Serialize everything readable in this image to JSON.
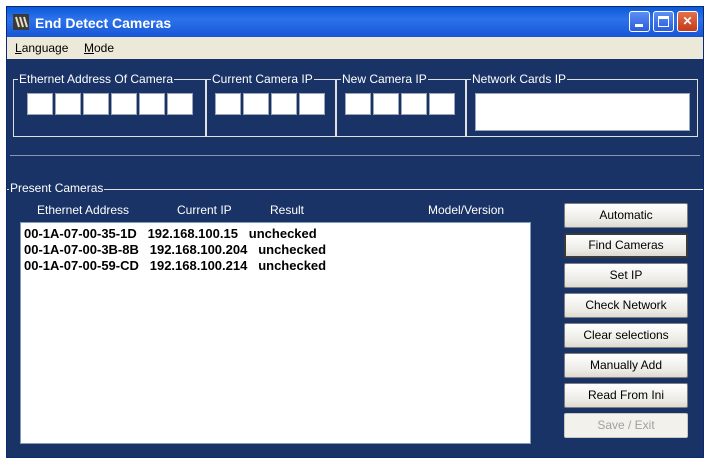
{
  "window": {
    "title": "End Detect Cameras",
    "icon": "app-icon"
  },
  "menu": {
    "items": [
      {
        "accel": "L",
        "rest": "anguage"
      },
      {
        "accel": "M",
        "rest": "ode"
      }
    ]
  },
  "groups": {
    "ethernet": {
      "label": "Ethernet Address Of Camera",
      "cells": 6
    },
    "current_ip": {
      "label": "Current Camera IP",
      "cells": 4
    },
    "new_ip": {
      "label": "New Camera IP",
      "cells": 4
    },
    "network_cards": {
      "label": "Network Cards IP"
    }
  },
  "present": {
    "label": "Present Cameras",
    "columns": {
      "ethernet": "Ethernet Address",
      "current_ip": "Current IP",
      "result": "Result",
      "model": "Model/Version"
    },
    "rows": [
      {
        "mac": "00-1A-07-00-35-1D",
        "ip": "192.168.100.15",
        "result": "unchecked"
      },
      {
        "mac": "00-1A-07-00-3B-8B",
        "ip": "192.168.100.204",
        "result": "unchecked"
      },
      {
        "mac": "00-1A-07-00-59-CD",
        "ip": "192.168.100.214",
        "result": "unchecked"
      }
    ]
  },
  "buttons": {
    "automatic": "Automatic",
    "find_cameras": "Find Cameras",
    "set_ip": "Set IP",
    "check_network": "Check Network",
    "clear_selections": "Clear selections",
    "manually_add": "Manually Add",
    "read_from_ini": "Read From Ini",
    "save_exit": "Save / Exit"
  },
  "colors": {
    "window_bg": "#1a3366",
    "titlebar": "#0a5ad8",
    "menu_bg": "#ece9d8"
  }
}
